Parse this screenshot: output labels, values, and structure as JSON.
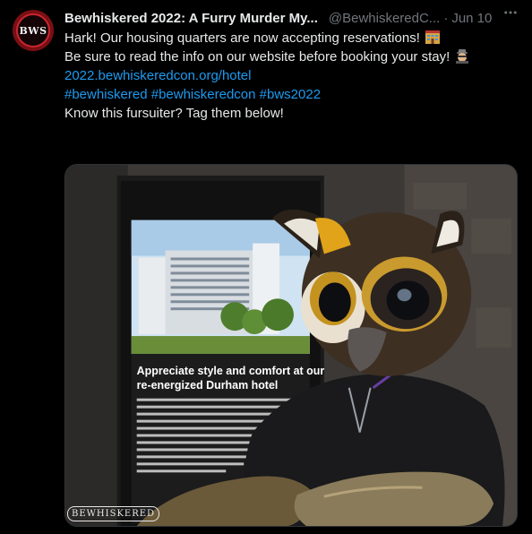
{
  "author": {
    "name": "Bewhiskered 2022: A Furry Murder My...",
    "handle": "@BewhiskeredC...",
    "date": "Jun 10",
    "avatar_text": "BWS"
  },
  "tweet": {
    "line1": "Hark! Our housing quarters are now accepting reservations!",
    "line2": "Be sure to read the info on our website before booking your stay!",
    "link": "2022.bewhiskeredcon.org/hotel",
    "hashtags": [
      "#bewhiskered",
      "#bewhiskeredcon",
      "#bws2022"
    ],
    "line5": "Know this fursuiter? Tag them below!"
  },
  "media": {
    "poster_heading_1": "Appreciate style and comfort at our",
    "poster_heading_2": "re-energized Durham hotel",
    "watermark": "BEWHISKERED"
  },
  "colors": {
    "background": "#000000",
    "text": "#e7e9ea",
    "secondary": "#71767b",
    "link": "#1d9bf0"
  },
  "icons": [
    "more-icon",
    "hotel-emoji-icon",
    "detective-emoji-icon"
  ]
}
